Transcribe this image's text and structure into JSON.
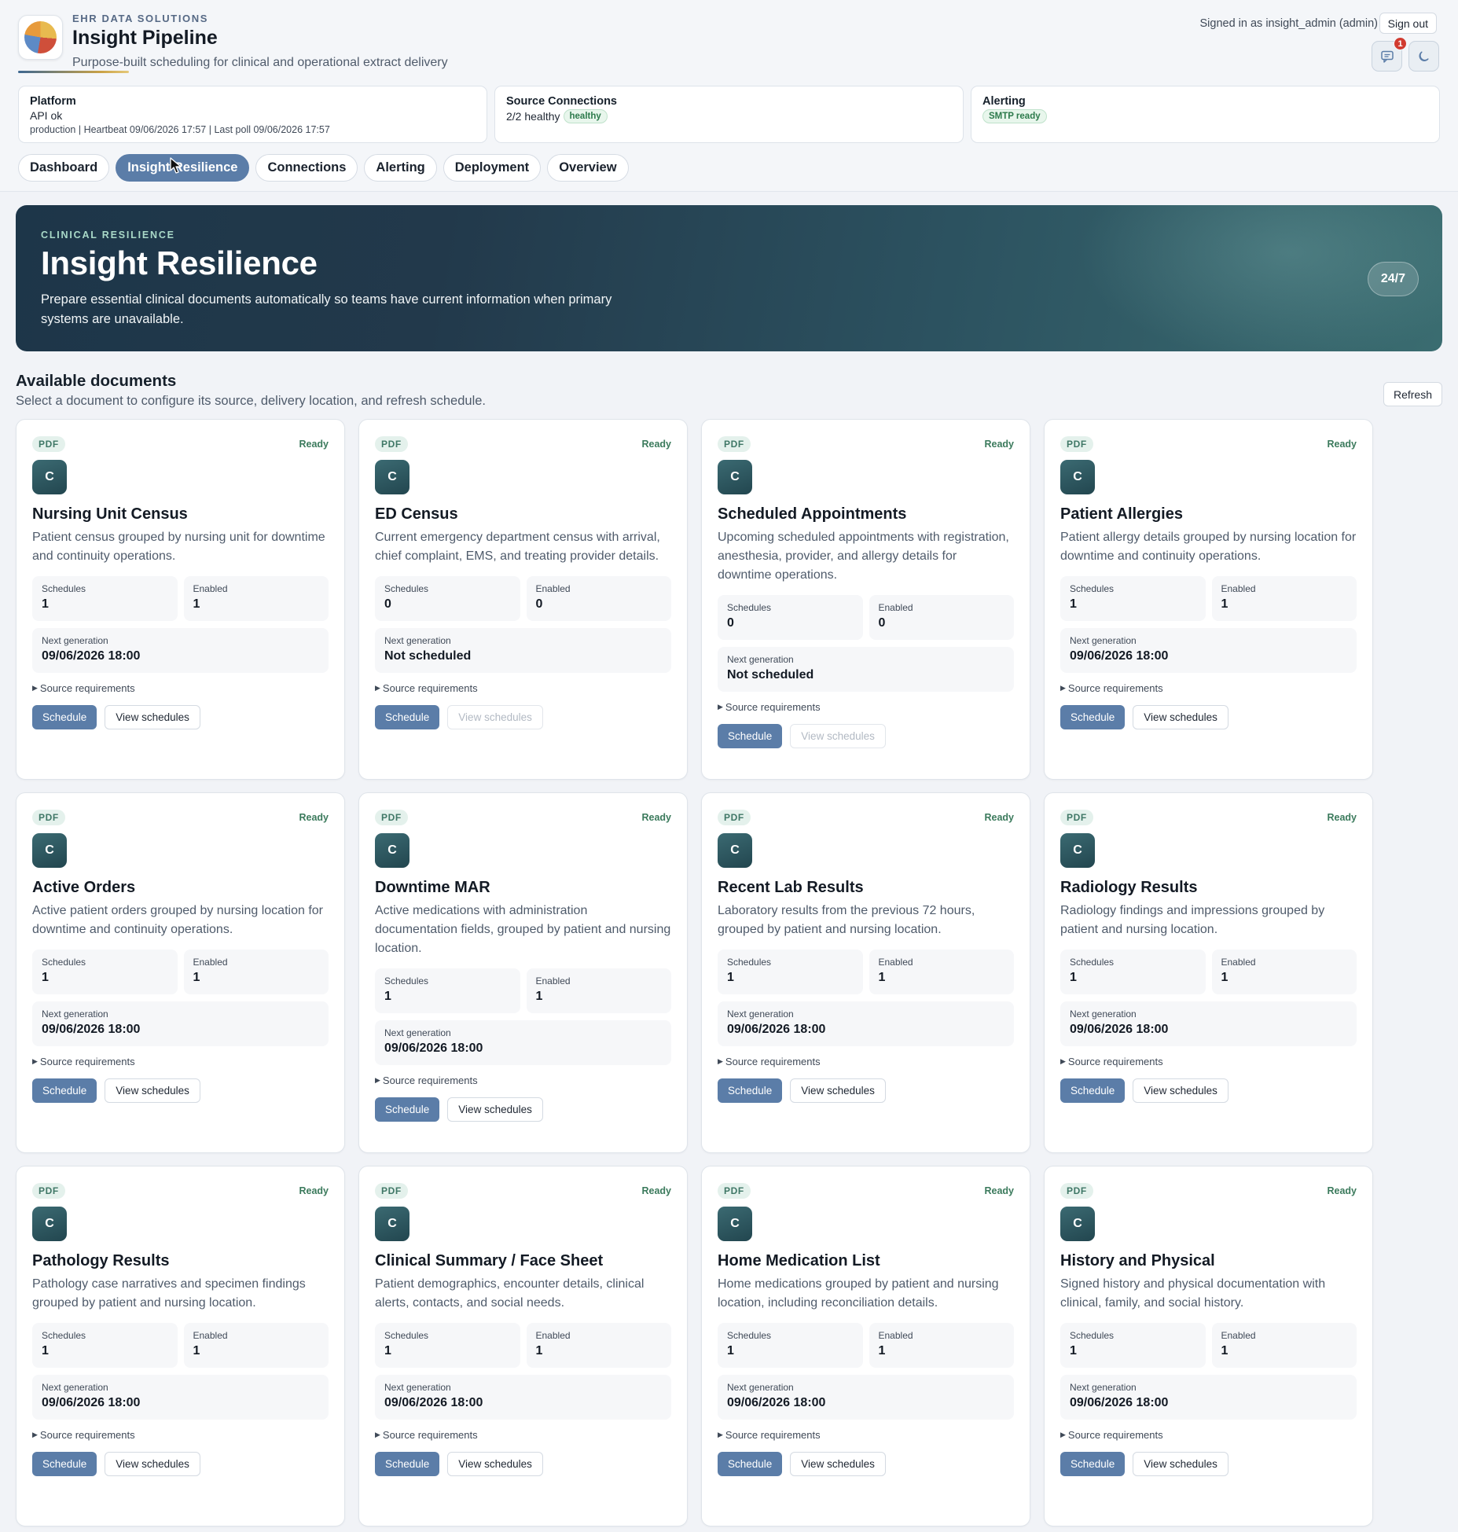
{
  "brand": {
    "kicker": "EHR DATA SOLUTIONS",
    "title": "Insight Pipeline",
    "subtitle": "Purpose-built scheduling for clinical and operational extract delivery",
    "logo_icon": "pie-chart-logo"
  },
  "user": {
    "signed_in_text": "Signed in as insight_admin (admin)",
    "sign_out_label": "Sign out",
    "notification_count": "1",
    "chat_icon": "chat-icon",
    "theme_icon": "moon-icon"
  },
  "status": {
    "platform": {
      "title": "Platform",
      "line": "API ok",
      "meta": "production | Heartbeat 09/06/2026 17:57 | Last poll 09/06/2026 17:57"
    },
    "sources": {
      "title": "Source Connections",
      "line": "2/2 healthy",
      "badge": "healthy"
    },
    "alerting": {
      "title": "Alerting",
      "badge": "SMTP ready"
    }
  },
  "tabs": [
    {
      "label": "Dashboard",
      "active": false
    },
    {
      "label": "Insight Resilience",
      "active": true
    },
    {
      "label": "Connections",
      "active": false
    },
    {
      "label": "Alerting",
      "active": false
    },
    {
      "label": "Deployment",
      "active": false
    },
    {
      "label": "Overview",
      "active": false
    }
  ],
  "hero": {
    "kicker": "CLINICAL RESILIENCE",
    "title": "Insight Resilience",
    "description": "Prepare essential clinical documents automatically so teams have current information when primary systems are unavailable.",
    "pill": "24/7"
  },
  "section": {
    "title": "Available documents",
    "subtitle": "Select a document to configure its source, delivery location, and refresh schedule.",
    "refresh_label": "Refresh"
  },
  "card_labels": {
    "format": "PDF",
    "status": "Ready",
    "avatar_letter": "C",
    "schedules_label": "Schedules",
    "enabled_label": "Enabled",
    "next_label": "Next generation",
    "source_req_label": "Source requirements",
    "schedule_button": "Schedule",
    "view_button": "View schedules"
  },
  "documents": [
    {
      "title": "Nursing Unit Census",
      "description": "Patient census grouped by nursing unit for downtime and continuity operations.",
      "schedules": "1",
      "enabled": "1",
      "next": "09/06/2026 18:00",
      "view_enabled": true
    },
    {
      "title": "ED Census",
      "description": "Current emergency department census with arrival, chief complaint, EMS, and treating provider details.",
      "schedules": "0",
      "enabled": "0",
      "next": "Not scheduled",
      "view_enabled": false
    },
    {
      "title": "Scheduled Appointments",
      "description": "Upcoming scheduled appointments with registration, anesthesia, provider, and allergy details for downtime operations.",
      "schedules": "0",
      "enabled": "0",
      "next": "Not scheduled",
      "view_enabled": false
    },
    {
      "title": "Patient Allergies",
      "description": "Patient allergy details grouped by nursing location for downtime and continuity operations.",
      "schedules": "1",
      "enabled": "1",
      "next": "09/06/2026 18:00",
      "view_enabled": true
    },
    {
      "title": "Active Orders",
      "description": "Active patient orders grouped by nursing location for downtime and continuity operations.",
      "schedules": "1",
      "enabled": "1",
      "next": "09/06/2026 18:00",
      "view_enabled": true
    },
    {
      "title": "Downtime MAR",
      "description": "Active medications with administration documentation fields, grouped by patient and nursing location.",
      "schedules": "1",
      "enabled": "1",
      "next": "09/06/2026 18:00",
      "view_enabled": true
    },
    {
      "title": "Recent Lab Results",
      "description": "Laboratory results from the previous 72 hours, grouped by patient and nursing location.",
      "schedules": "1",
      "enabled": "1",
      "next": "09/06/2026 18:00",
      "view_enabled": true
    },
    {
      "title": "Radiology Results",
      "description": "Radiology findings and impressions grouped by patient and nursing location.",
      "schedules": "1",
      "enabled": "1",
      "next": "09/06/2026 18:00",
      "view_enabled": true
    },
    {
      "title": "Pathology Results",
      "description": "Pathology case narratives and specimen findings grouped by patient and nursing location.",
      "schedules": "1",
      "enabled": "1",
      "next": "09/06/2026 18:00",
      "view_enabled": true
    },
    {
      "title": "Clinical Summary / Face Sheet",
      "description": "Patient demographics, encounter details, clinical alerts, contacts, and social needs.",
      "schedules": "1",
      "enabled": "1",
      "next": "09/06/2026 18:00",
      "view_enabled": true
    },
    {
      "title": "Home Medication List",
      "description": "Home medications grouped by patient and nursing location, including reconciliation details.",
      "schedules": "1",
      "enabled": "1",
      "next": "09/06/2026 18:00",
      "view_enabled": true
    },
    {
      "title": "History and Physical",
      "description": "Signed history and physical documentation with clinical, family, and social history.",
      "schedules": "1",
      "enabled": "1",
      "next": "09/06/2026 18:00",
      "view_enabled": true
    }
  ],
  "colors": {
    "accent": "#5b7da8",
    "hero_dark": "#1d3649",
    "hero_teal": "#3a6c70",
    "ready_green": "#3b7a5c",
    "alert_red": "#d13a2f"
  }
}
